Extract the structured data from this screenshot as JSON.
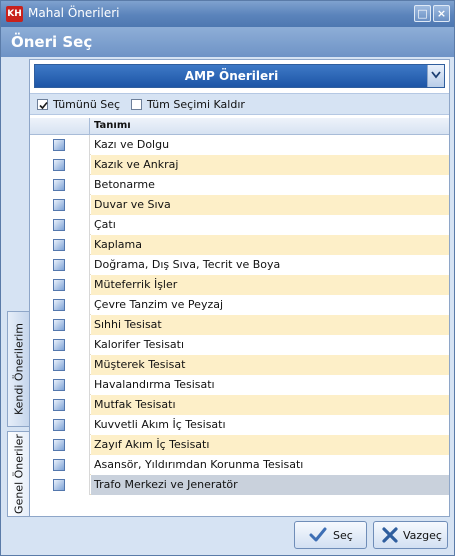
{
  "window": {
    "icon_text": "KH",
    "title": "Mahal Önerileri",
    "maximize": "□",
    "close": "×"
  },
  "header": {
    "title": "Öneri Seç"
  },
  "combo": {
    "value": "AMP Önerileri"
  },
  "selection_bar": {
    "select_all": "Tümünü Seç",
    "clear_all": "Tüm Seçimi Kaldır"
  },
  "grid": {
    "column_header": "Tanımı",
    "rows": [
      "Kazı ve Dolgu",
      "Kazık ve Ankraj",
      "Betonarme",
      "Duvar ve Sıva",
      "Çatı",
      "Kaplama",
      "Doğrama, Dış Sıva, Tecrit ve Boya",
      "Müteferrik İşler",
      "Çevre Tanzim ve Peyzaj",
      "Sıhhi Tesisat",
      "Kalorifer Tesisatı",
      "Müşterek Tesisat",
      "Havalandırma Tesisatı",
      "Mutfak Tesisatı",
      "Kuvvetli Akım İç Tesisatı",
      "Zayıf Akım İç Tesisatı",
      "Asansör, Yıldırımdan Korunma Tesisatı",
      "Trafo Merkezi ve Jeneratör"
    ]
  },
  "side_tabs": {
    "own": "Kendi Önerilerim",
    "general": "Genel Öneriler"
  },
  "buttons": {
    "select": "Seç",
    "cancel": "Vazgeç"
  },
  "colors": {
    "accent": "#1d55a6",
    "row_alt": "#fdefc8",
    "row_selected": "#c9d1dc"
  }
}
